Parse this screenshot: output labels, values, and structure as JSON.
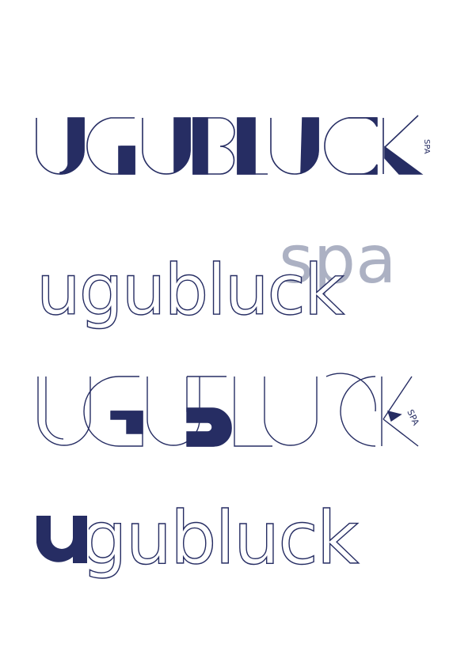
{
  "page": {
    "background": "#ffffff"
  },
  "colors": {
    "navy": "#262d63",
    "grey": "#acb1c3"
  },
  "logos": [
    {
      "id": "logo-1",
      "wordmark": "UGUBLUCK",
      "tag": "SPA",
      "style": "uppercase geometric, partly filled"
    },
    {
      "id": "logo-2",
      "wordmark": "ugubluck",
      "tag": "spa",
      "style": "lowercase outline with large grey spa behind"
    },
    {
      "id": "logo-3",
      "wordmark": "UGUBLUCK",
      "tag": "SPA",
      "style": "uppercase thin line art with filled accents"
    },
    {
      "id": "logo-4",
      "wordmark": "ugubluck",
      "tag": "",
      "style": "lowercase outline with filled first u"
    }
  ]
}
